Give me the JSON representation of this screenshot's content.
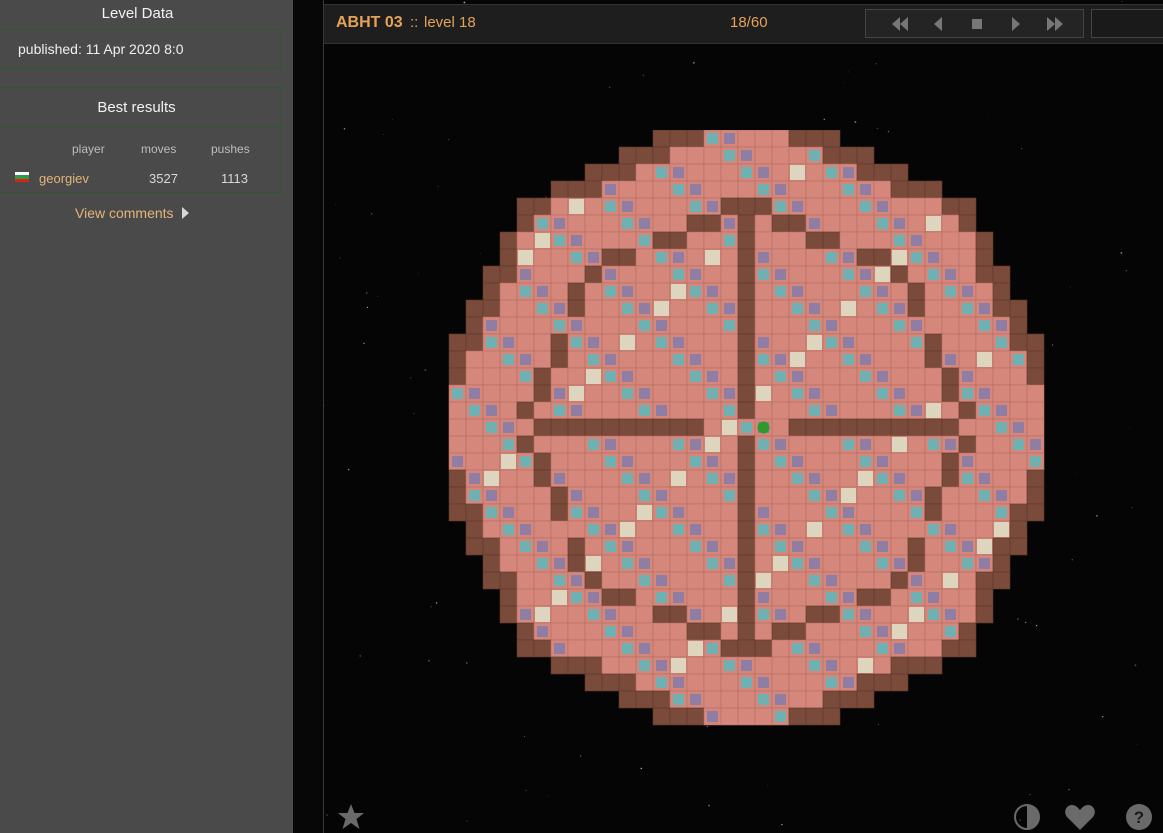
{
  "sidebar": {
    "level_data_title": "Level Data",
    "published": "published: 11 Apr 2020 8:0",
    "best_results_title": "Best results",
    "columns": [
      "player",
      "moves",
      "pushes"
    ],
    "results": [
      {
        "player": "georgiev",
        "moves": "3527",
        "pushes": "1113",
        "flag_colors": [
          "#ffffff",
          "#2e9a4b",
          "#d62612"
        ]
      }
    ],
    "view_comments": "View comments"
  },
  "topbar": {
    "collection": "ABHT 03",
    "separator": "::",
    "level": "level 18",
    "counter": "18/60"
  },
  "nav": [
    "first-icon",
    "previous-icon",
    "stop-icon",
    "next-icon",
    "last-icon"
  ],
  "bottom_icons": [
    "star-icon",
    "contrast-icon",
    "heart-icon",
    "help-icon"
  ],
  "colors": {
    "accent": "#e5a35a",
    "sidebar_bg": "#4a4a4a",
    "wall": "#7a4a3a",
    "floor": "#d4877a",
    "goal": "#6fb0b3",
    "box": "#8f7da4",
    "box_on_goal": "#ddd5bd",
    "player": "#2e9a2e"
  }
}
